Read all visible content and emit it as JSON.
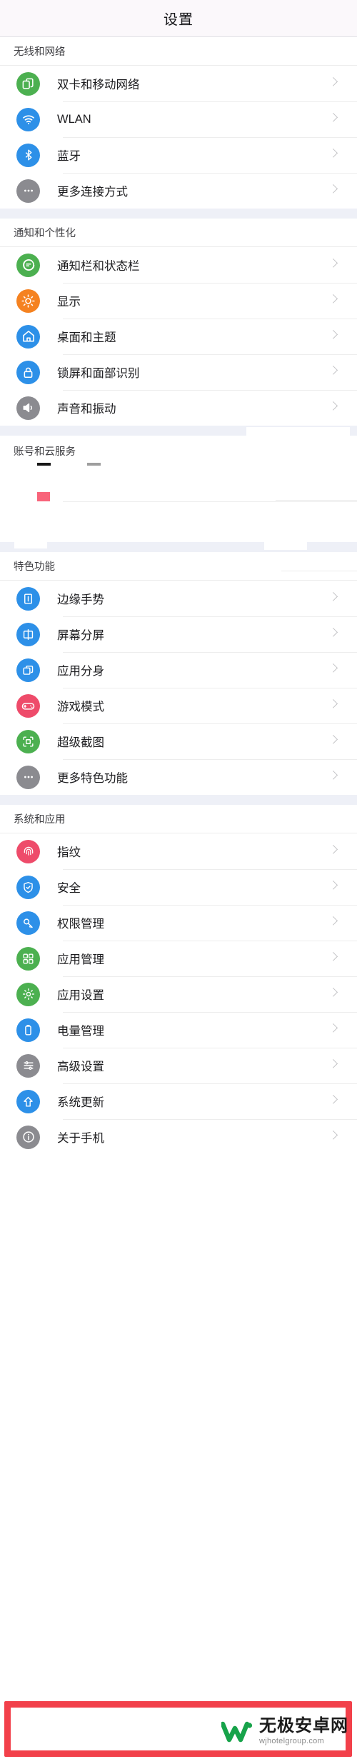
{
  "header": {
    "title": "设置"
  },
  "sections": [
    {
      "name": "wireless-network",
      "title": "无线和网络",
      "items": [
        {
          "label": "双卡和移动网络",
          "icon": "sim-cards-icon",
          "color": "#4cb050"
        },
        {
          "label": "WLAN",
          "icon": "wifi-icon",
          "color": "#2d90e8"
        },
        {
          "label": "蓝牙",
          "icon": "bluetooth-icon",
          "color": "#2d90e8"
        },
        {
          "label": "更多连接方式",
          "icon": "more-dots-icon",
          "color": "#8b8b90"
        }
      ]
    },
    {
      "name": "notification-personalization",
      "title": "通知和个性化",
      "items": [
        {
          "label": "通知栏和状态栏",
          "icon": "chat-bubble-icon",
          "color": "#4cb050"
        },
        {
          "label": "显示",
          "icon": "brightness-sun-icon",
          "color": "#f58220"
        },
        {
          "label": "桌面和主题",
          "icon": "home-house-icon",
          "color": "#2d90e8"
        },
        {
          "label": "锁屏和面部识别",
          "icon": "lock-icon",
          "color": "#2d90e8"
        },
        {
          "label": "声音和振动",
          "icon": "speaker-volume-icon",
          "color": "#8b8b90"
        }
      ]
    },
    {
      "name": "account-cloud",
      "title": "账号和云服务",
      "corrupted": true,
      "items": [
        {
          "label": "",
          "icon": "corrupted-icon",
          "color": "#ffffff"
        },
        {
          "label": "",
          "icon": "corrupted-icon",
          "color": "#ffffff"
        }
      ]
    },
    {
      "name": "feature-functions",
      "title": "特色功能",
      "items": [
        {
          "label": "边缘手势",
          "icon": "edge-gesture-icon",
          "color": "#2d90e8"
        },
        {
          "label": "屏幕分屏",
          "icon": "split-screen-icon",
          "color": "#2d90e8"
        },
        {
          "label": "应用分身",
          "icon": "app-clone-icon",
          "color": "#2d90e8"
        },
        {
          "label": "游戏模式",
          "icon": "gamepad-icon",
          "color": "#ee4b6a"
        },
        {
          "label": "超级截图",
          "icon": "screenshot-icon",
          "color": "#4cb050"
        },
        {
          "label": "更多特色功能",
          "icon": "more-dots-icon",
          "color": "#8b8b90"
        }
      ]
    },
    {
      "name": "system-apps",
      "title": "系统和应用",
      "items": [
        {
          "label": "指纹",
          "icon": "fingerprint-icon",
          "color": "#ee4b6a"
        },
        {
          "label": "安全",
          "icon": "shield-icon",
          "color": "#2d90e8"
        },
        {
          "label": "权限管理",
          "icon": "key-permission-icon",
          "color": "#2d90e8"
        },
        {
          "label": "应用管理",
          "icon": "apps-grid-icon",
          "color": "#4cb050"
        },
        {
          "label": "应用设置",
          "icon": "gear-settings-icon",
          "color": "#4cb050"
        },
        {
          "label": "电量管理",
          "icon": "battery-icon",
          "color": "#2d90e8"
        },
        {
          "label": "高级设置",
          "icon": "sliders-icon",
          "color": "#8b8b90"
        },
        {
          "label": "系统更新",
          "icon": "update-arrow-up-icon",
          "color": "#2d90e8"
        },
        {
          "label": "关于手机",
          "icon": "info-circle-icon",
          "color": "#8b8b90",
          "highlighted": true
        }
      ]
    }
  ],
  "highlight": {
    "color": "#f2404a"
  },
  "watermark": {
    "brand": "无极安卓网",
    "url": "wjhotelgroup.com",
    "logo_color": "#17a34a"
  }
}
